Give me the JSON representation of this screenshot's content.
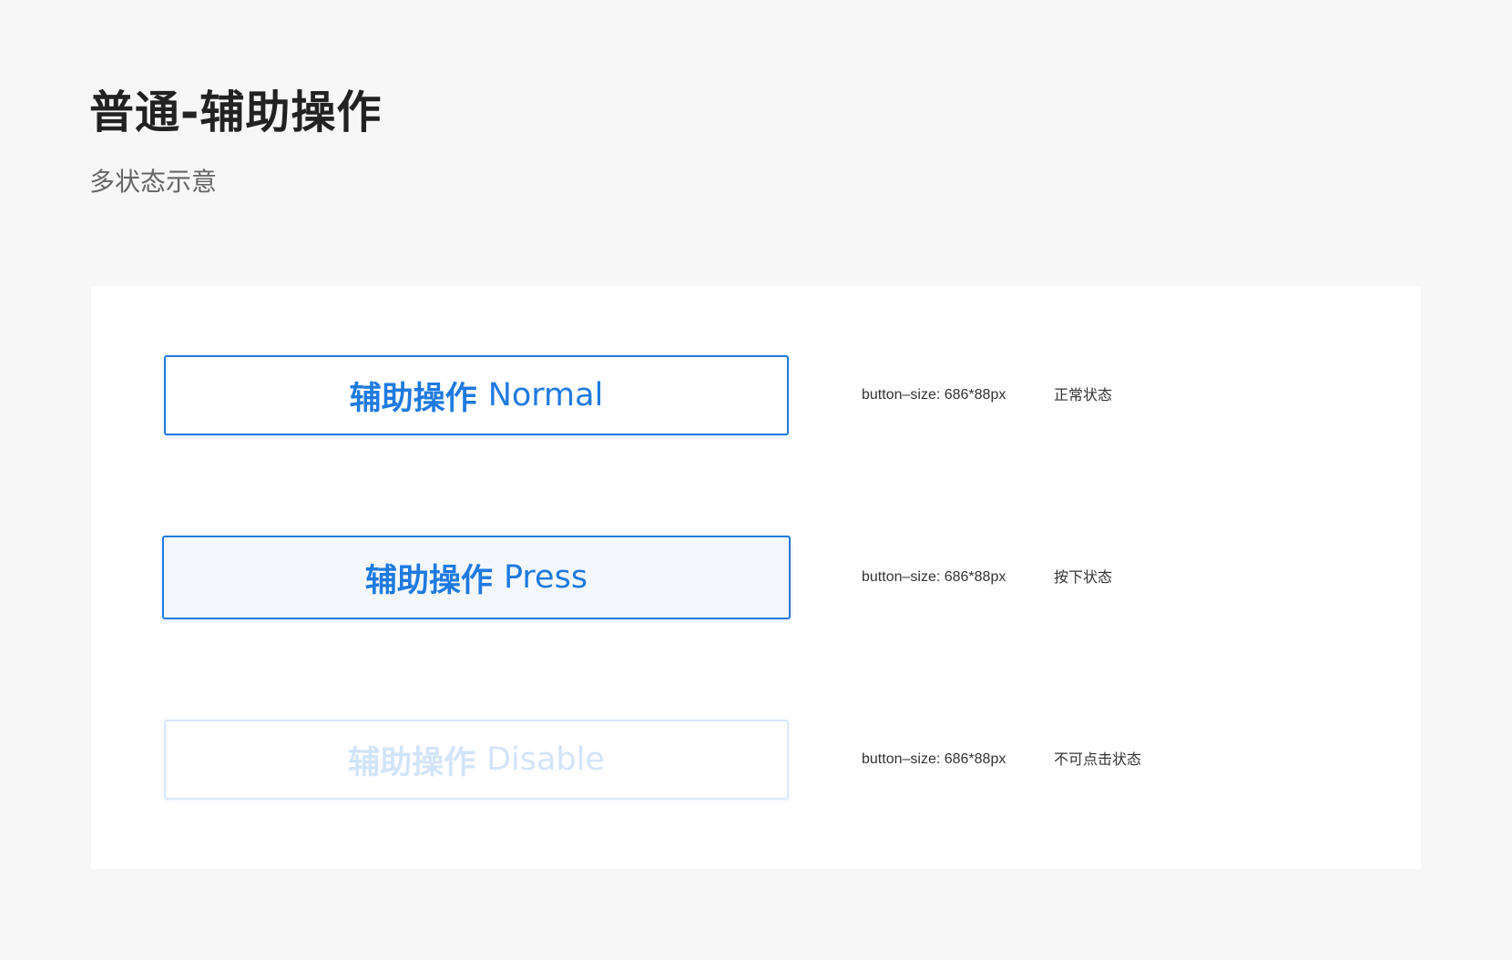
{
  "page": {
    "title": "普通-辅助操作",
    "subtitle": "多状态示意"
  },
  "colors": {
    "background": "#f7f7f7",
    "panel": "#ffffff",
    "accent": "#1f7ae0",
    "press_fill": "#f4f8fd",
    "disabled_text": "#d2e4f9",
    "disabled_border": "#d8e8fa"
  },
  "rows": [
    {
      "button_label_zh": "辅助操作",
      "button_label_en": "Normal",
      "spec": "button–size: 686*88px",
      "state": "正常状态"
    },
    {
      "button_label_zh": "辅助操作",
      "button_label_en": "Press",
      "spec": "button–size: 686*88px",
      "state": "按下状态"
    },
    {
      "button_label_zh": "辅助操作",
      "button_label_en": "Disable",
      "spec": "button–size: 686*88px",
      "state": "不可点击状态"
    }
  ]
}
